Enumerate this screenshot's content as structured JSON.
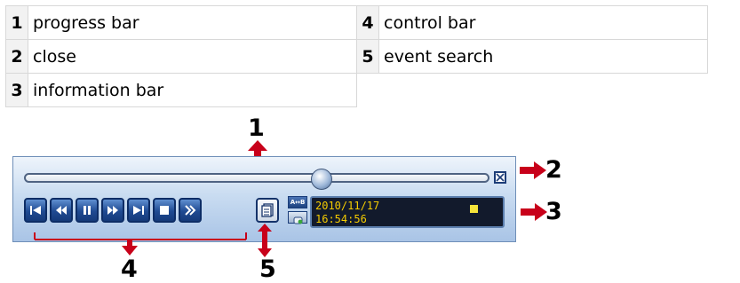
{
  "legend": {
    "rows": [
      {
        "left_num": "1",
        "left_label": "progress bar",
        "right_num": "4",
        "right_label": "control bar"
      },
      {
        "left_num": "2",
        "left_label": "close",
        "right_num": "5",
        "right_label": "event search"
      },
      {
        "left_num": "3",
        "left_label": "information bar",
        "right_num": "",
        "right_label": ""
      }
    ]
  },
  "callouts": [
    "1",
    "2",
    "3",
    "4",
    "5"
  ],
  "player": {
    "progress_fraction": 0.64,
    "controls": [
      {
        "name": "skip-to-start",
        "icon": "skip-start-icon"
      },
      {
        "name": "rewind",
        "icon": "rewind-icon"
      },
      {
        "name": "pause",
        "icon": "pause-icon"
      },
      {
        "name": "fast-forward",
        "icon": "fast-forward-icon"
      },
      {
        "name": "skip-to-end",
        "icon": "skip-end-icon"
      },
      {
        "name": "stop",
        "icon": "stop-icon"
      },
      {
        "name": "slow-forward",
        "icon": "double-chevron-right-icon"
      }
    ],
    "ab_repeat_label": "A↔B",
    "info": {
      "date": "2010/11/17",
      "time": "16:54:56",
      "indicator_color": "#f6e43a"
    }
  },
  "colors": {
    "arrow": "#c8001a",
    "player_border": "#6f8fb8",
    "button_fill": "#1f4a92",
    "info_text": "#f5cc00"
  }
}
